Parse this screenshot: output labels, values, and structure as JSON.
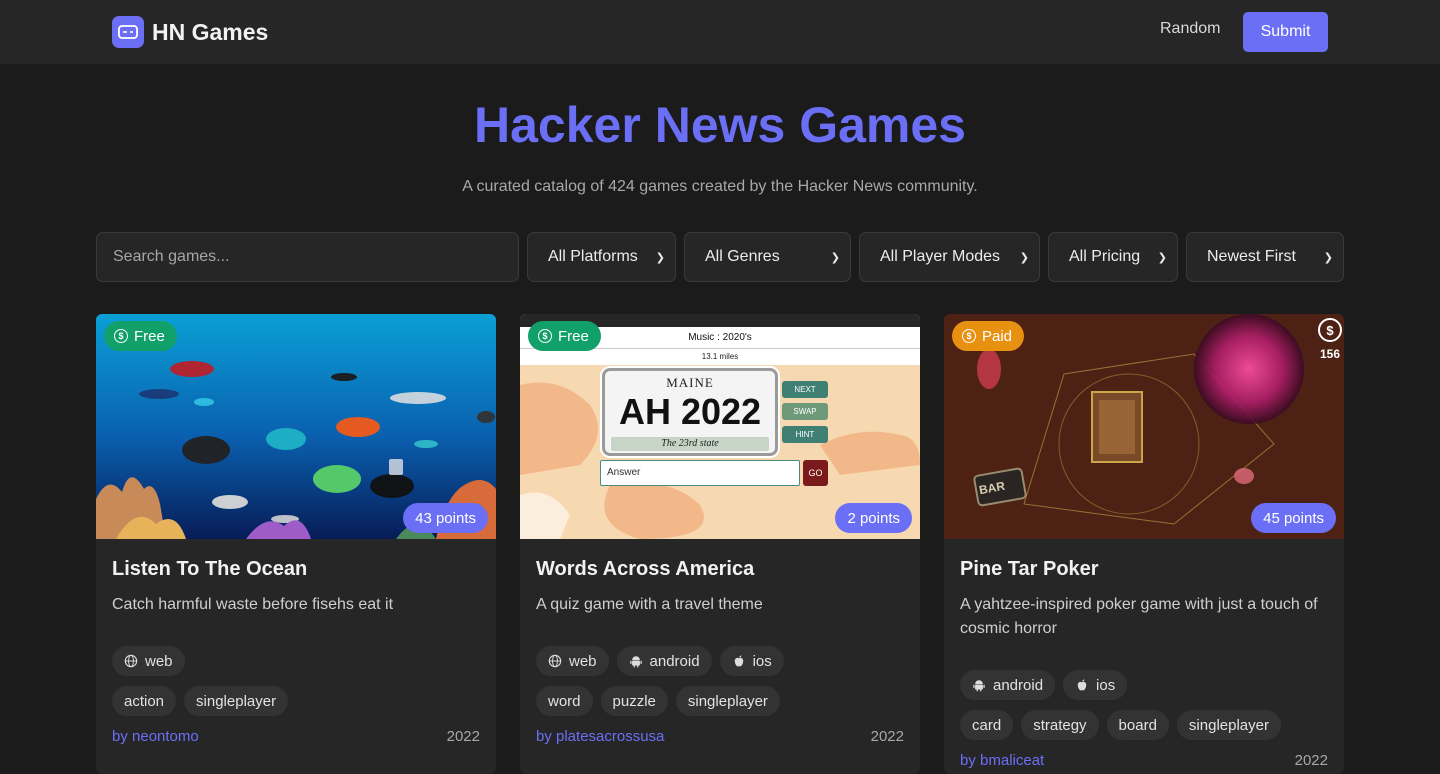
{
  "header": {
    "brand": "HN Games",
    "random_label": "Random",
    "submit_label": "Submit"
  },
  "hero": {
    "title": "Hacker News Games",
    "subtitle": "A curated catalog of 424 games created by the Hacker News community."
  },
  "filters": {
    "search_placeholder": "Search games...",
    "platforms": "All Platforms",
    "genres": "All Genres",
    "player_modes": "All Player Modes",
    "pricing": "All Pricing",
    "sort": "Newest First"
  },
  "cards": [
    {
      "title": "Listen To The Ocean",
      "description": "Catch harmful waste before fisehs eat it",
      "price": "Free",
      "points": "43 points",
      "platforms": [
        "web"
      ],
      "genres": [
        "action",
        "singleplayer"
      ],
      "author": "by neontomo",
      "year": "2022"
    },
    {
      "title": "Words Across America",
      "description": "A quiz game with a travel theme",
      "price": "Free",
      "points": "2 points",
      "platforms": [
        "web",
        "android",
        "ios"
      ],
      "genres": [
        "word",
        "puzzle",
        "singleplayer"
      ],
      "author": "by platesacrossusa",
      "year": "2022",
      "screenshot": {
        "music": "Music : 2020's",
        "distance": "13.1 miles",
        "plate_state": "MAINE",
        "plate_number": "AH 2022",
        "plate_caption": "The 23rd state",
        "btn_next": "NEXT",
        "btn_swap": "SWAP",
        "btn_hint": "HINT",
        "answer_placeholder": "Answer",
        "go": "GO"
      }
    },
    {
      "title": "Pine Tar Poker",
      "description": "A yahtzee-inspired poker game with just a touch of cosmic horror",
      "price": "Paid",
      "points": "45 points",
      "platforms": [
        "android",
        "ios"
      ],
      "genres": [
        "card",
        "strategy",
        "board",
        "singleplayer"
      ],
      "author": "by bmaliceat",
      "year": "2022",
      "screenshot": {
        "coins": "156",
        "sign": "BAR"
      }
    }
  ],
  "colors": {
    "accent": "#6b6ff5",
    "free": "#11a06a",
    "paid": "#e8900f",
    "bg": "#1b1b1b",
    "surface": "#262626"
  }
}
